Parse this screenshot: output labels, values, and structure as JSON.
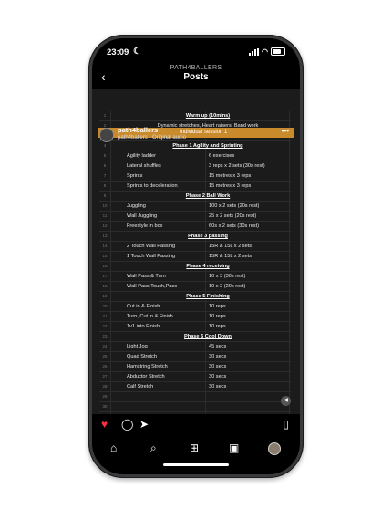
{
  "status": {
    "time": "23:09",
    "moon_icon": "moon-icon"
  },
  "header": {
    "account": "PATH4BALLERS",
    "title": "Posts"
  },
  "post": {
    "username": "path4ballers",
    "audio": "path4ballers · Original audio",
    "banner_text": "Individual session 1"
  },
  "sheet": {
    "col_headers": [
      "A",
      "B",
      "C"
    ],
    "rows": [
      {
        "n": "1",
        "type": "header",
        "text": "Warm up (10mins)"
      },
      {
        "n": "2",
        "type": "center",
        "text": "Dynamic stretches, Heart raisers, Band work"
      },
      {
        "n": "3",
        "type": "blank"
      },
      {
        "n": "4",
        "type": "header",
        "text": "Phase 1 Agility and Sprinting"
      },
      {
        "n": "5",
        "a": "Agility ladder",
        "b": "6 exercises"
      },
      {
        "n": "6",
        "a": "Lateral shuffles",
        "b": "3 reps x 2 sets (30s rest)"
      },
      {
        "n": "7",
        "a": "Sprints",
        "b": "15 metres x 3 reps"
      },
      {
        "n": "8",
        "a": "Sprints to deceleration",
        "b": "15 metres x 3 reps"
      },
      {
        "n": "9",
        "type": "header",
        "text": "Phase 2 Ball Work"
      },
      {
        "n": "10",
        "a": "Juggling",
        "b": "100 x 2 sets (20s rest)"
      },
      {
        "n": "11",
        "a": "Wall Juggling",
        "b": "25 x 2 sets (20s rest)"
      },
      {
        "n": "12",
        "a": "Freestyle in box",
        "b": "60s x 2 sets (30s rest)"
      },
      {
        "n": "13",
        "type": "header",
        "text": "Phase 3 passing"
      },
      {
        "n": "14",
        "a": "2 Touch Wall Passing",
        "b": "15R & 15L x 2 sets"
      },
      {
        "n": "15",
        "a": "1 Touch Wall Passing",
        "b": "15R & 15L x 2 sets"
      },
      {
        "n": "16",
        "type": "header",
        "text": "Phase 4 receiving"
      },
      {
        "n": "17",
        "a": "Wall Pass & Turn",
        "b": "10 x 3 (30s rest)"
      },
      {
        "n": "18",
        "a": "Wall Pass,Touch,Pass",
        "b": "10 x 2 (20s rest)"
      },
      {
        "n": "19",
        "type": "header",
        "text": "Phase 5 Finishing"
      },
      {
        "n": "20",
        "a": "Cut in & Finish",
        "b": "10 reps"
      },
      {
        "n": "21",
        "a": "Turn, Cut in & Finish",
        "b": "10 reps"
      },
      {
        "n": "22",
        "a": "1v1 into Finish",
        "b": "10 reps"
      },
      {
        "n": "23",
        "type": "header",
        "text": "Phase 6 Cool Down"
      },
      {
        "n": "24",
        "a": "Light Jog",
        "b": "45 secs"
      },
      {
        "n": "25",
        "a": "Quad Stretch",
        "b": "30 secs"
      },
      {
        "n": "26",
        "a": "Hamstring Stretch",
        "b": "30 secs"
      },
      {
        "n": "27",
        "a": "Abductor Stretch",
        "b": "30 secs"
      },
      {
        "n": "28",
        "a": "Calf Stretch",
        "b": "30 secs"
      },
      {
        "n": "29",
        "type": "blank"
      },
      {
        "n": "30",
        "type": "blank"
      },
      {
        "n": "31",
        "type": "blank"
      },
      {
        "n": "32",
        "type": "blank"
      },
      {
        "n": "33",
        "type": "blank"
      },
      {
        "n": "34",
        "type": "blank"
      }
    ]
  },
  "icons": {
    "like": "heart-filled-icon",
    "comment": "comment-icon",
    "share": "send-icon",
    "save": "bookmark-icon",
    "home": "home-icon",
    "search": "search-icon",
    "create": "plus-square-icon",
    "reels": "reels-icon",
    "profile": "avatar"
  },
  "colors": {
    "like": "#ff3040",
    "banner": "#c88a2a",
    "background": "#000000"
  }
}
